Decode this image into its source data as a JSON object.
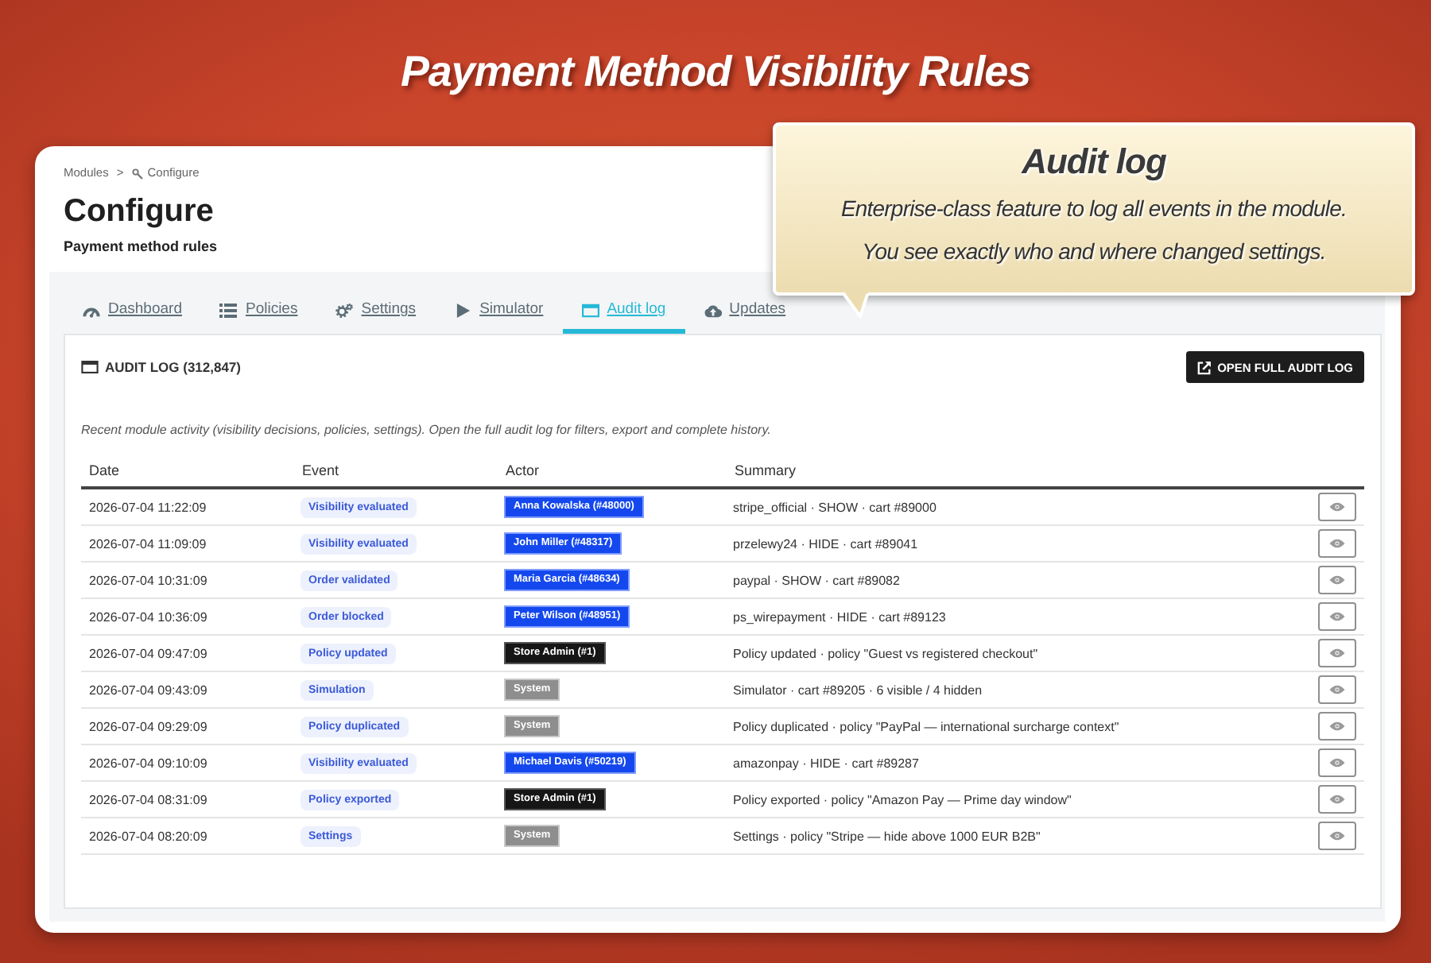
{
  "heading": "Payment Method Visibility Rules",
  "callout": {
    "title": "Audit log",
    "lines": [
      "Enterprise-class feature to log all events in the module.",
      "You see exactly who and where changed settings."
    ]
  },
  "breadcrumb": {
    "items": [
      "Modules",
      "Configure"
    ],
    "separator": ">"
  },
  "page": {
    "title": "Configure",
    "subtitle": "Payment method rules"
  },
  "tabs": [
    {
      "label": "Dashboard",
      "selected": false
    },
    {
      "label": "Policies",
      "selected": false
    },
    {
      "label": "Settings",
      "selected": false
    },
    {
      "label": "Simulator",
      "selected": false
    },
    {
      "label": "Audit log",
      "selected": true
    },
    {
      "label": "Updates",
      "selected": false
    }
  ],
  "panel": {
    "title": "AUDIT LOG (312,847)",
    "button": "OPEN FULL AUDIT LOG",
    "description": "Recent module activity (visibility decisions, policies, settings). Open the full audit log for filters, export and complete history.",
    "table": {
      "columns": [
        "Date",
        "Event",
        "Actor",
        "Summary"
      ],
      "rows": [
        {
          "date": "2026-07-04 11:22:09",
          "event": "Visibility evaluated",
          "actor": {
            "name": "Anna Kowalska (#48000)",
            "kind": "customer"
          },
          "summary": "stripe_official · SHOW · cart #89000"
        },
        {
          "date": "2026-07-04 11:09:09",
          "event": "Visibility evaluated",
          "actor": {
            "name": "John Miller (#48317)",
            "kind": "customer"
          },
          "summary": "przelewy24 · HIDE · cart #89041"
        },
        {
          "date": "2026-07-04 10:31:09",
          "event": "Order validated",
          "actor": {
            "name": "Maria Garcia (#48634)",
            "kind": "customer"
          },
          "summary": "paypal · SHOW · cart #89082"
        },
        {
          "date": "2026-07-04 10:36:09",
          "event": "Order blocked",
          "actor": {
            "name": "Peter Wilson (#48951)",
            "kind": "customer"
          },
          "summary": "ps_wirepayment · HIDE · cart #89123"
        },
        {
          "date": "2026-07-04 09:47:09",
          "event": "Policy updated",
          "actor": {
            "name": "Store Admin (#1)",
            "kind": "admin"
          },
          "summary": "Policy updated · policy \"Guest vs registered checkout\""
        },
        {
          "date": "2026-07-04 09:43:09",
          "event": "Simulation",
          "actor": {
            "name": "System",
            "kind": "system"
          },
          "summary": "Simulator · cart #89205 · 6 visible / 4 hidden"
        },
        {
          "date": "2026-07-04 09:29:09",
          "event": "Policy duplicated",
          "actor": {
            "name": "System",
            "kind": "system"
          },
          "summary": "Policy duplicated · policy \"PayPal — international surcharge context\""
        },
        {
          "date": "2026-07-04 09:10:09",
          "event": "Visibility evaluated",
          "actor": {
            "name": "Michael Davis (#50219)",
            "kind": "customer"
          },
          "summary": "amazonpay · HIDE · cart #89287"
        },
        {
          "date": "2026-07-04 08:31:09",
          "event": "Policy exported",
          "actor": {
            "name": "Store Admin (#1)",
            "kind": "admin"
          },
          "summary": "Policy exported · policy \"Amazon Pay — Prime day window\""
        },
        {
          "date": "2026-07-04 08:20:09",
          "event": "Settings",
          "actor": {
            "name": "System",
            "kind": "system"
          },
          "summary": "Settings · policy \"Stripe — hide above 1000 EUR B2B\""
        }
      ]
    }
  }
}
